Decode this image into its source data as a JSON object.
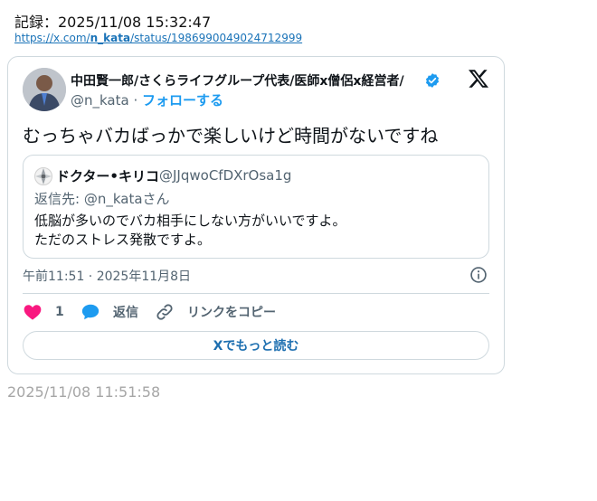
{
  "record": {
    "header": "記録：2025/11/08 15:32:47",
    "url_prefix": "https://x.com/",
    "url_user": "n_kata",
    "url_suffix": "/status/1986990049024712999"
  },
  "tweet": {
    "author_name": "中田賢一郎/さくらライフグループ代表/医師x僧侶x経営者/",
    "handle": "@n_kata",
    "separator": " · ",
    "follow_label": "フォローする",
    "text": "むっちゃバカばっかで楽しいけど時間がないですね",
    "quote": {
      "name": "ドクター•キリコ",
      "handle": "@JJqwoCfDXrOsa1g",
      "reply_to": "返信先: @n_kataさん",
      "text_line1": "低脳が多いのでバカ相手にしない方がいいですよ。",
      "text_line2": "ただのストレス発散ですよ。"
    },
    "timestamp": "午前11:51 · 2025年11月8日",
    "actions": {
      "like_count": "1",
      "reply_label": "返信",
      "copy_label": "リンクをコピー"
    },
    "read_more_label": "Xでもっと読む"
  },
  "archive_time": "2025/11/08 11:51:58",
  "colors": {
    "accent_blue": "#1d9bf0",
    "like_pink": "#f91880",
    "text_primary": "#0f1419",
    "text_secondary": "#536471",
    "border": "#cfd9de"
  },
  "icons": [
    "verified-badge-icon",
    "x-logo-icon",
    "info-icon",
    "heart-icon",
    "reply-bubble-icon",
    "link-icon"
  ]
}
